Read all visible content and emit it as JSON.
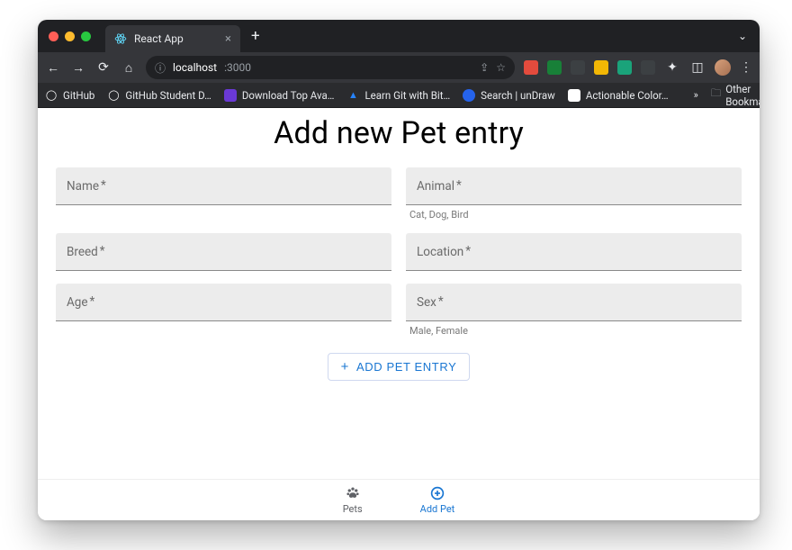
{
  "browser": {
    "tab_title": "React App",
    "url_host": "localhost",
    "url_port": ":3000",
    "traffic_colors": {
      "close": "#ff5f57",
      "min": "#febc2e",
      "max": "#28c840"
    }
  },
  "bookmarks": [
    {
      "icon": "github",
      "label": "GitHub"
    },
    {
      "icon": "github",
      "label": "GitHub Student D…"
    },
    {
      "icon": "download",
      "label": "Download Top Ava…"
    },
    {
      "icon": "atlassian",
      "label": "Learn Git with Bit…"
    },
    {
      "icon": "undraw",
      "label": "Search | unDraw"
    },
    {
      "icon": "color",
      "label": "Actionable Color…"
    }
  ],
  "bookmarks_overflow": "»",
  "other_bookmarks_label": "Other Bookmarks",
  "extensions": [
    {
      "name": "ext-red",
      "color": "#e34b3d"
    },
    {
      "name": "ext-green",
      "color": "#188038"
    },
    {
      "name": "ext-dark1",
      "color": "#3c4043"
    },
    {
      "name": "ext-yellow",
      "color": "#f2b705"
    },
    {
      "name": "ext-teal",
      "color": "#1aa37a"
    },
    {
      "name": "ext-dark2",
      "color": "#3c4043"
    }
  ],
  "page": {
    "title": "Add new Pet entry",
    "fields": {
      "name": {
        "label": "Name",
        "required": true
      },
      "animal": {
        "label": "Animal",
        "required": true,
        "helper": "Cat, Dog, Bird"
      },
      "breed": {
        "label": "Breed",
        "required": true
      },
      "location": {
        "label": "Location",
        "required": true
      },
      "age": {
        "label": "Age",
        "required": true
      },
      "sex": {
        "label": "Sex",
        "required": true,
        "helper": "Male, Female"
      }
    },
    "submit_label": "ADD PET ENTRY"
  },
  "bottom_nav": {
    "pets": {
      "label": "Pets",
      "active": false
    },
    "add_pet": {
      "label": "Add Pet",
      "active": true
    }
  }
}
